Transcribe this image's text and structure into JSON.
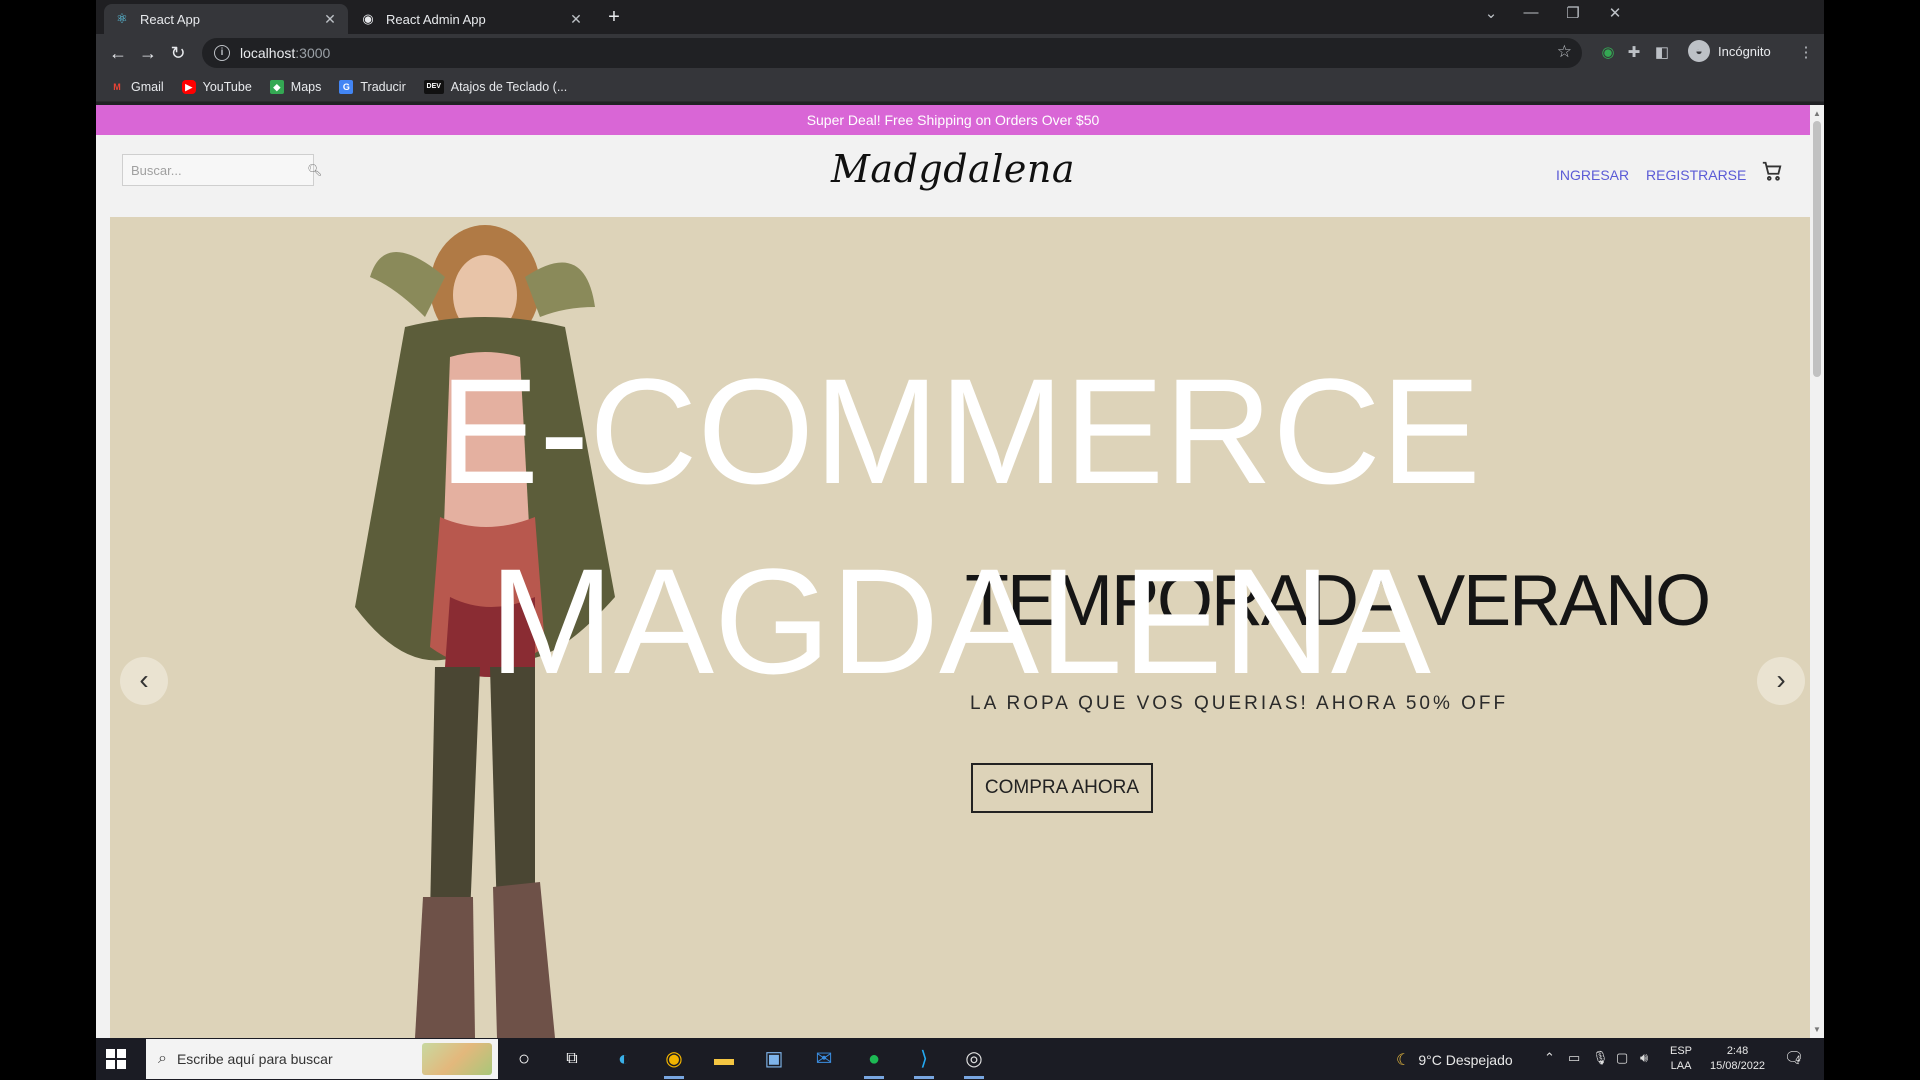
{
  "browser": {
    "tabs": [
      {
        "title": "React App",
        "active": true
      },
      {
        "title": "React Admin App",
        "active": false
      }
    ],
    "new_tab_icon": "plus",
    "url_host": "localhost",
    "url_port": ":3000",
    "profile_label": "Incógnito",
    "bookmarks": [
      {
        "label": "Gmail",
        "icon": "gmail-icon",
        "color": "#ea4335"
      },
      {
        "label": "YouTube",
        "icon": "youtube-icon",
        "color": "#ff0000"
      },
      {
        "label": "Maps",
        "icon": "maps-icon",
        "color": "#34a853"
      },
      {
        "label": "Traducir",
        "icon": "translate-icon",
        "color": "#4285f4"
      },
      {
        "label": "Atajos de Teclado (...",
        "icon": "dev-icon",
        "color": "#111111"
      }
    ]
  },
  "site": {
    "announcement": "Super Deal! Free Shipping on Orders Over $50",
    "search_placeholder": "Buscar...",
    "logo": "Madgdalena",
    "nav": {
      "login": "INGRESAR",
      "register": "REGISTRARSE"
    },
    "slide": {
      "title": "TEMPORADA VERANO",
      "description": "LA ROPA QUE VOS QUERIAS! AHORA 50% OFF",
      "button": "COMPRA AHORA",
      "background": "#ddd3b9"
    },
    "overlay_line1": "E-COMMERCE",
    "overlay_line2": "MAGDALENA",
    "accent_color": "#d966d6",
    "link_color": "#5b5bd6"
  },
  "taskbar": {
    "search_placeholder": "Escribe aquí para buscar",
    "apps": [
      "cortana",
      "task-view",
      "edge",
      "chrome",
      "file-explorer",
      "store",
      "mail",
      "spotify",
      "vscode",
      "other-app"
    ],
    "weather": "9°C  Despejado",
    "lang_top": "ESP",
    "lang_bottom": "LAA",
    "time": "2:48",
    "date": "15/08/2022",
    "notifications": "4"
  }
}
